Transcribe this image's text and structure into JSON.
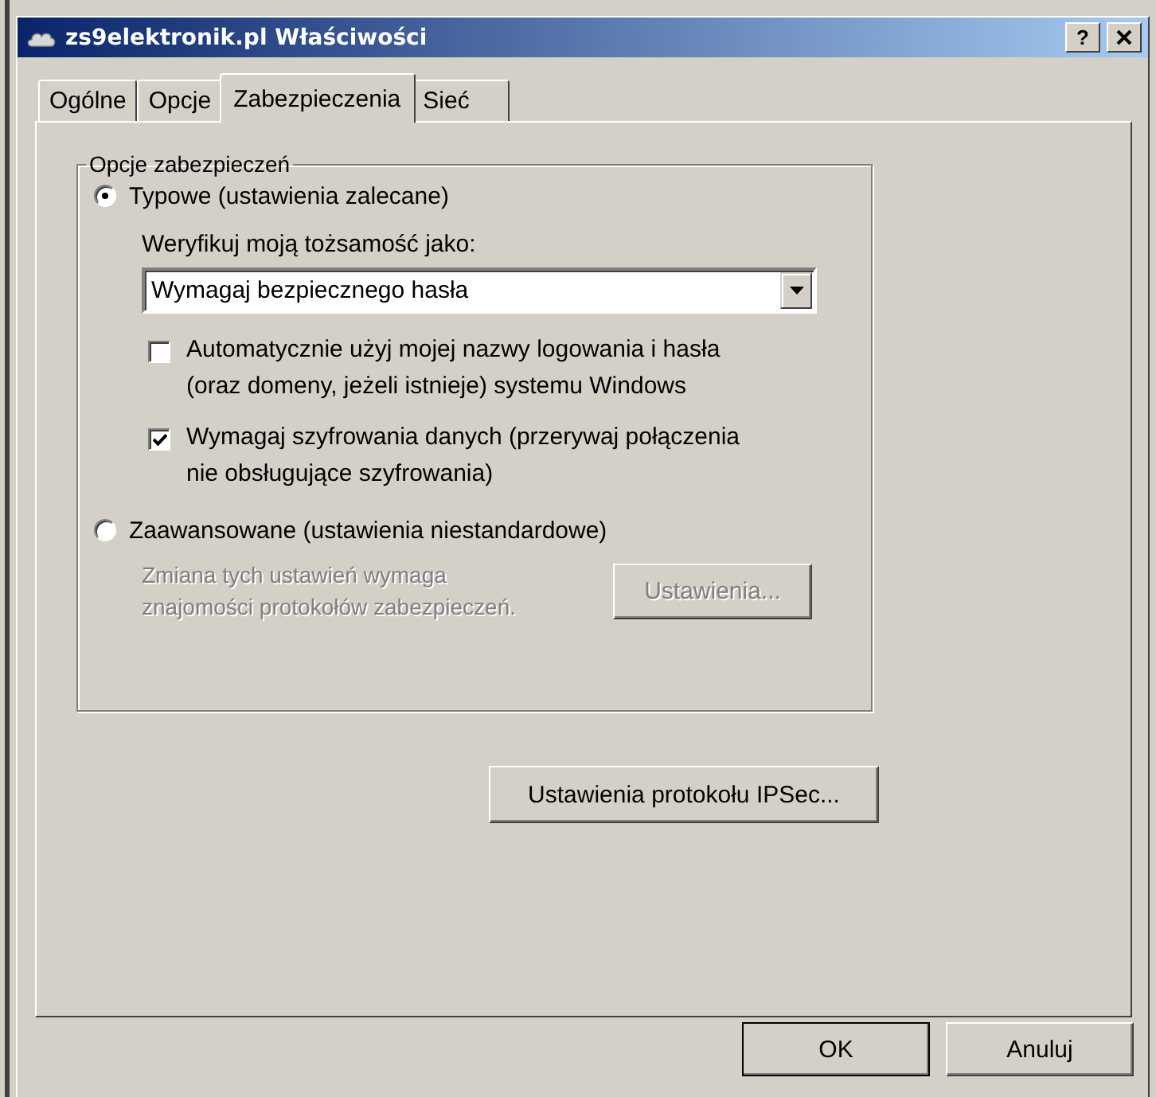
{
  "window": {
    "title": "zs9elektronik.pl Właściwości",
    "help_button": "?"
  },
  "tabs": [
    {
      "label": "Ogólne",
      "selected": false
    },
    {
      "label": "Opcje",
      "selected": false
    },
    {
      "label": "Zabezpieczenia",
      "selected": true
    },
    {
      "label": "Sieć",
      "selected": false
    }
  ],
  "group": {
    "title": "Opcje zabezpieczeń",
    "options": [
      {
        "kind": "typical",
        "label": "Typowe (ustawienia zalecane)",
        "selected": true,
        "verify_label": "Weryfikuj moją tożsamość jako:",
        "dropdown_value": "Wymagaj bezpiecznego hasła",
        "checkboxes": [
          {
            "label": "Automatycznie użyj mojej nazwy logowania i hasła\n(oraz domeny, jeżeli istnieje) systemu Windows",
            "checked": false
          },
          {
            "label": "Wymagaj szyfrowania danych (przerywaj połączenia\nnie obsługujące szyfrowania)",
            "checked": true
          }
        ]
      },
      {
        "kind": "advanced",
        "label": "Zaawansowane (ustawienia niestandardowe)",
        "selected": false,
        "note": "Zmiana tych ustawień wymaga\nznajomości protokołów zabezpieczeń.",
        "button": {
          "label": "Ustawienia...",
          "disabled": true
        }
      }
    ]
  },
  "ipsec_button": "Ustawienia protokołu IPSec...",
  "buttons": [
    {
      "label": "OK",
      "default": true
    },
    {
      "label": "Anuluj",
      "default": false
    }
  ]
}
